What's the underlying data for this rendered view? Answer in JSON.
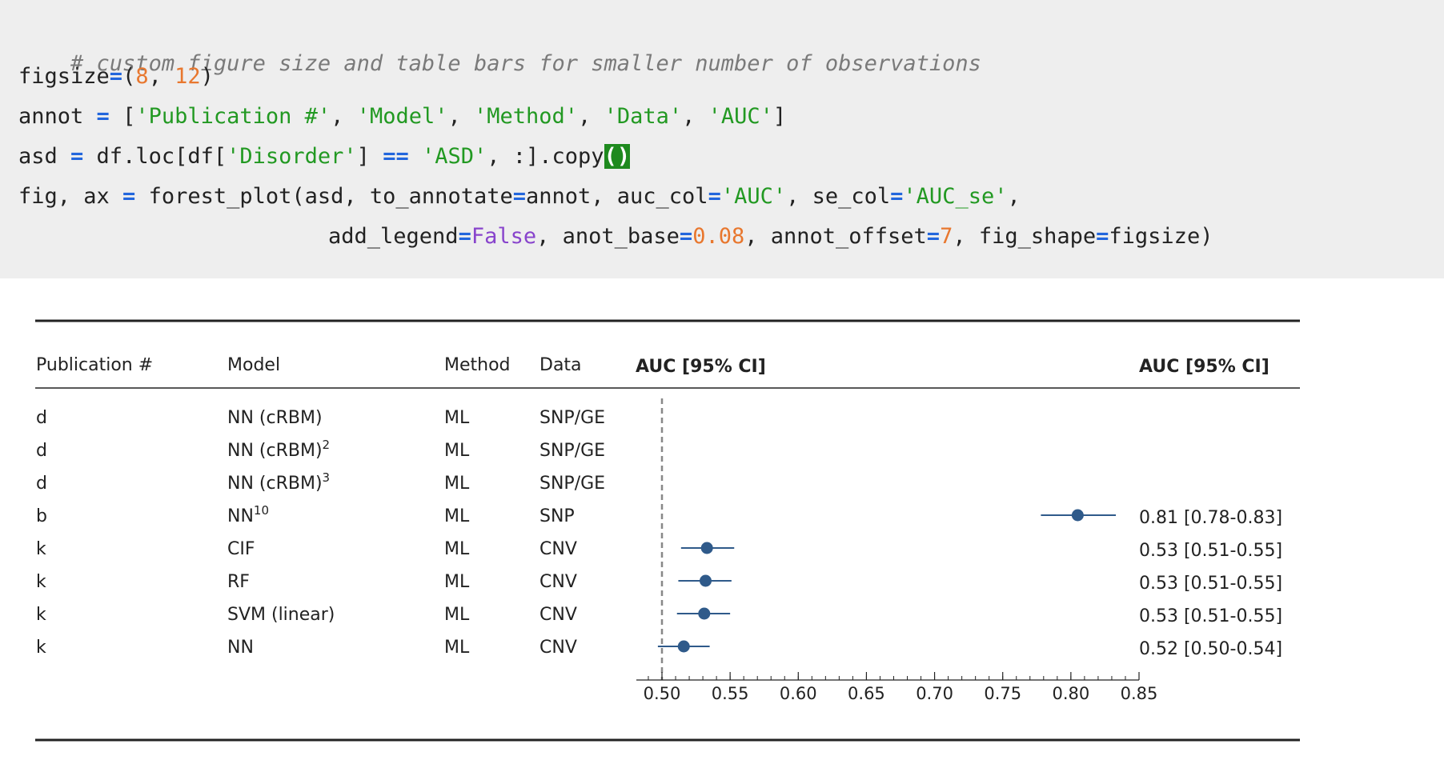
{
  "code": {
    "comment": "# custom figure size and table bars for smaller number of observations",
    "l2": {
      "var": "figsize",
      "eq": "=",
      "p1": "(",
      "n1": "8",
      "sep": ", ",
      "n2": "12",
      "p2": ")"
    },
    "l3": {
      "var": "annot ",
      "eq": "=",
      "open": " [",
      "s1": "'Publication #'",
      "c1": ", ",
      "s2": "'Model'",
      "c2": ", ",
      "s3": "'Method'",
      "c3": ", ",
      "s4": "'Data'",
      "c4": ", ",
      "s5": "'AUC'",
      "close": "]"
    },
    "l4": {
      "var": "asd ",
      "eq": "=",
      "a": " df.loc[df[",
      "s1": "'Disorder'",
      "b": "] ",
      "eqeq": "==",
      "sp": " ",
      "s2": "'ASD'",
      "c": ", :].copy",
      "cursor": "()"
    },
    "l5": {
      "var": "fig, ax ",
      "eq": "=",
      "a": " forest_plot(asd, to_annotate",
      "eq2": "=",
      "b": "annot, auc_col",
      "eq3": "=",
      "s1": "'AUC'",
      "c": ", se_col",
      "eq4": "=",
      "s2": "'AUC_se'",
      "d": ","
    },
    "l6": {
      "a": "add_legend",
      "eq1": "=",
      "kw": "False",
      "b": ", anot_base",
      "eq2": "=",
      "n1": "0.08",
      "c": ", annot_offset",
      "eq3": "=",
      "n2": "7",
      "d": ", fig_shape",
      "eq4": "=",
      "e": "figsize)"
    }
  },
  "chart_data": {
    "type": "forest",
    "columns": [
      "Publication #",
      "Model",
      "Method",
      "Data"
    ],
    "ci_header_left": "AUC [95%  CI]",
    "ci_header_right": "AUC [95%  CI]",
    "rows": [
      {
        "pub": "d",
        "model": "NN (cRBM)",
        "sup": "",
        "method": "ML",
        "data": "SNP/GE",
        "auc": null,
        "lo": null,
        "hi": null,
        "label": ""
      },
      {
        "pub": "d",
        "model": "NN (cRBM)",
        "sup": "2",
        "method": "ML",
        "data": "SNP/GE",
        "auc": null,
        "lo": null,
        "hi": null,
        "label": ""
      },
      {
        "pub": "d",
        "model": "NN (cRBM)",
        "sup": "3",
        "method": "ML",
        "data": "SNP/GE",
        "auc": null,
        "lo": null,
        "hi": null,
        "label": ""
      },
      {
        "pub": "b",
        "model": "NN",
        "sup": "10",
        "method": "ML",
        "data": "SNP",
        "auc": 0.805,
        "lo": 0.778,
        "hi": 0.833,
        "label": "0.81 [0.78-0.83]"
      },
      {
        "pub": "k",
        "model": "CIF",
        "sup": "",
        "method": "ML",
        "data": "CNV",
        "auc": 0.533,
        "lo": 0.514,
        "hi": 0.553,
        "label": "0.53 [0.51-0.55]"
      },
      {
        "pub": "k",
        "model": "RF",
        "sup": "",
        "method": "ML",
        "data": "CNV",
        "auc": 0.532,
        "lo": 0.512,
        "hi": 0.551,
        "label": "0.53 [0.51-0.55]"
      },
      {
        "pub": "k",
        "model": "SVM (linear)",
        "sup": "",
        "method": "ML",
        "data": "CNV",
        "auc": 0.531,
        "lo": 0.511,
        "hi": 0.55,
        "label": "0.53 [0.51-0.55]"
      },
      {
        "pub": "k",
        "model": "NN",
        "sup": "",
        "method": "ML",
        "data": "CNV",
        "auc": 0.516,
        "lo": 0.497,
        "hi": 0.535,
        "label": "0.52 [0.50-0.54]"
      }
    ],
    "reference_line": 0.5,
    "xlim": [
      0.48,
      0.85
    ],
    "xticks": [
      0.5,
      0.55,
      0.6,
      0.65,
      0.7,
      0.75,
      0.8,
      0.85
    ],
    "xtick_labels": [
      "0.50",
      "0.55",
      "0.60",
      "0.65",
      "0.70",
      "0.75",
      "0.80",
      "0.85"
    ],
    "marker_color": "#2f5a8a"
  }
}
